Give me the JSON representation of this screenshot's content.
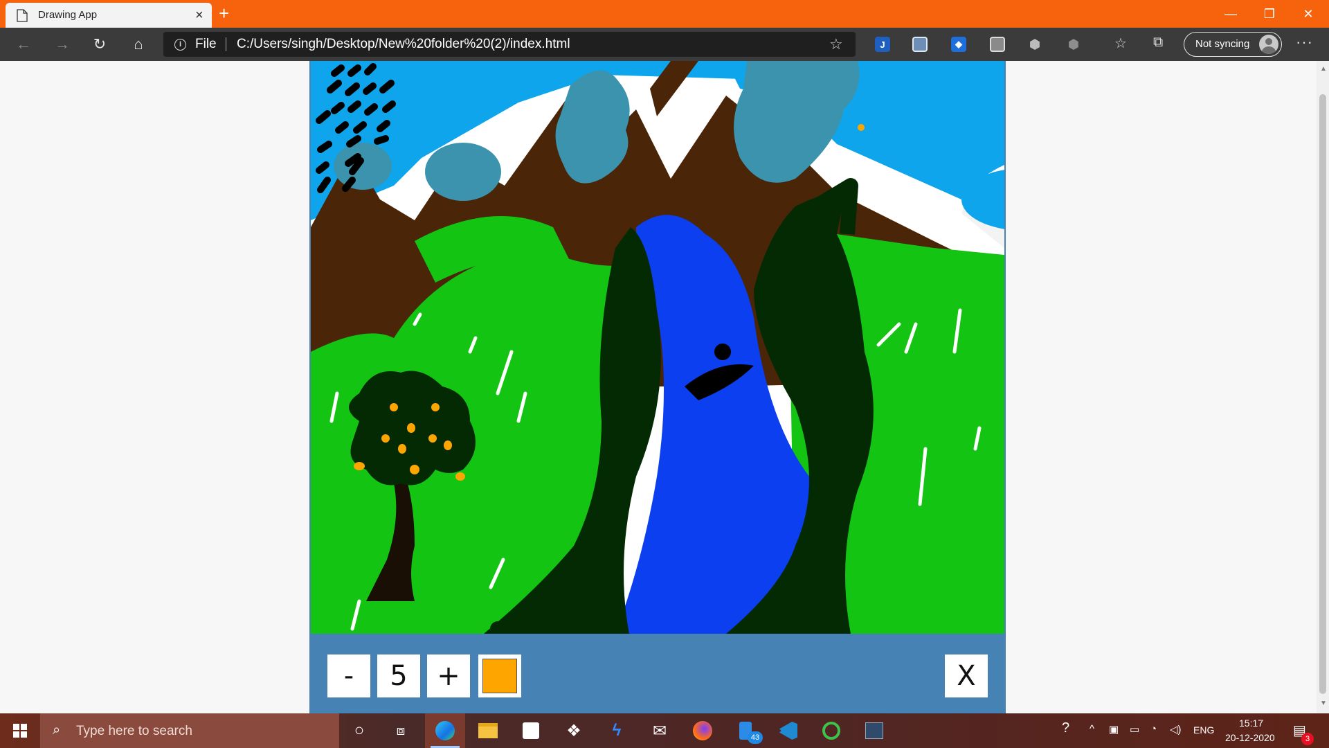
{
  "browser": {
    "tab_title": "Drawing App",
    "tab_close": "×",
    "new_tab": "+",
    "window_controls": {
      "minimize": "—",
      "restore": "❐",
      "close": "✕"
    },
    "address": {
      "scheme_label": "File",
      "url": "C:/Users/singh/Desktop/New%20folder%20(2)/index.html"
    },
    "sync_label": "Not syncing",
    "more_label": "···",
    "extensions": [
      "jira-icon",
      "bitwarden-icon",
      "shield-icon",
      "screenshot-icon",
      "privacy-badger-icon",
      "adblock-icon"
    ]
  },
  "app": {
    "toolbox": {
      "decrease_label": "-",
      "size_value": "5",
      "increase_label": "+",
      "color_value": "#ffa500",
      "clear_label": "X"
    },
    "colors": {
      "toolbox_bg": "#4682b4",
      "sky": "#0ea5ec",
      "mountain": "#4a2507",
      "grass": "#13c413",
      "river": "#0b3ff0",
      "tree_dark": "#042a04",
      "cloud": "#3c93ad",
      "fruit": "#ffa500"
    }
  },
  "taskbar": {
    "search_placeholder": "Type here to search",
    "apps": [
      "cortana-icon",
      "task-view-icon",
      "edge-icon",
      "file-explorer-icon",
      "store-icon",
      "dropbox-icon",
      "vscode-alt-icon",
      "mail-icon",
      "firefox-icon",
      "phone-icon",
      "vscode-icon",
      "sync-icon",
      "snip-icon"
    ],
    "phone_badge": "43",
    "tray": {
      "language": "ENG",
      "time": "15:17",
      "date": "20-12-2020",
      "notification_count": "3"
    }
  }
}
